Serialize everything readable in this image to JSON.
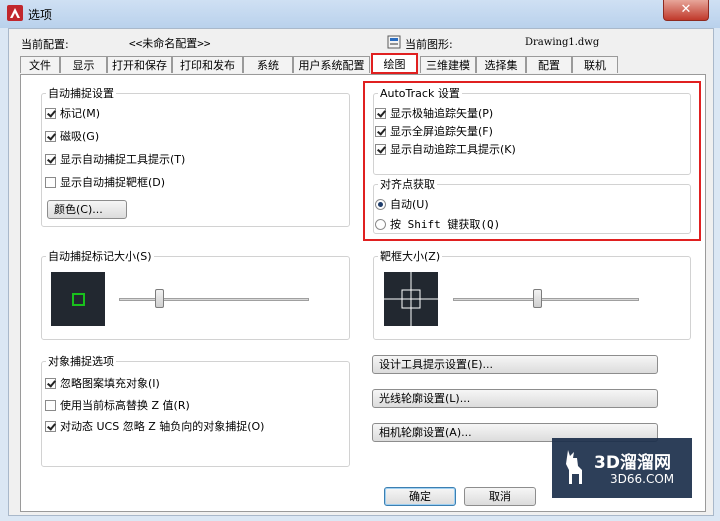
{
  "window": {
    "title": "选项",
    "close_glyph": "✕"
  },
  "profile": {
    "label": "当前配置:",
    "value": "<<未命名配置>>"
  },
  "drawing": {
    "label": "当前图形:",
    "value": "Drawing1.dwg"
  },
  "tabs": [
    "文件",
    "显示",
    "打开和保存",
    "打印和发布",
    "系统",
    "用户系统配置",
    "绘图",
    "三维建模",
    "选择集",
    "配置",
    "联机"
  ],
  "active_tab": "绘图",
  "autosnap": {
    "title": "自动捕捉设置",
    "options": [
      {
        "label": "标记(M)",
        "checked": true
      },
      {
        "label": "磁吸(G)",
        "checked": true
      },
      {
        "label": "显示自动捕捉工具提示(T)",
        "checked": true
      },
      {
        "label": "显示自动捕捉靶框(D)",
        "checked": false
      }
    ],
    "color_button": "颜色(C)..."
  },
  "autotrack": {
    "title": "AutoTrack 设置",
    "options": [
      {
        "label": "显示极轴追踪矢量(P)",
        "checked": true
      },
      {
        "label": "显示全屏追踪矢量(F)",
        "checked": true
      },
      {
        "label": "显示自动追踪工具提示(K)",
        "checked": true
      }
    ]
  },
  "alignment": {
    "title": "对齐点获取",
    "options": [
      {
        "label": "自动(U)",
        "selected": true
      },
      {
        "label": "按 Shift 键获取(Q)",
        "selected": false
      }
    ]
  },
  "marker_size": {
    "title": "自动捕捉标记大小(S)",
    "level": 0.2
  },
  "aperture_size": {
    "title": "靶框大小(Z)",
    "level": 0.45
  },
  "object_snap": {
    "title": "对象捕捉选项",
    "options": [
      {
        "label": "忽略图案填充对象(I)",
        "checked": true
      },
      {
        "label": "使用当前标高替换 Z 值(R)",
        "checked": false
      },
      {
        "label": "对动态 UCS 忽略 Z 轴负向的对象捕捉(O)",
        "checked": true
      }
    ]
  },
  "side_buttons": [
    "设计工具提示设置(E)...",
    "光线轮廓设置(L)...",
    "相机轮廓设置(A)..."
  ],
  "footer": {
    "ok": "确定",
    "cancel": "取消"
  },
  "watermark": {
    "big": "3D溜溜网",
    "small": "3D66.COM"
  },
  "colors": {
    "highlight": "#e02020",
    "marker": "#19c01c",
    "preview_bg": "#222830"
  }
}
